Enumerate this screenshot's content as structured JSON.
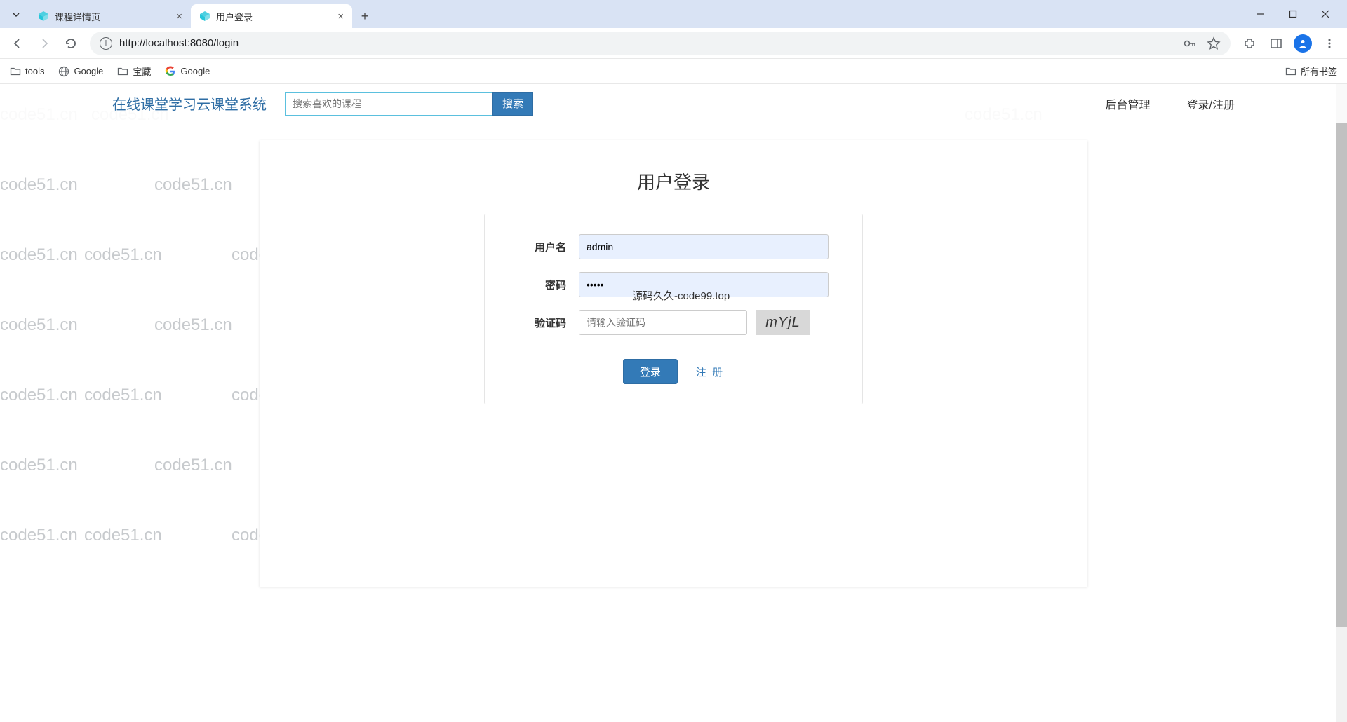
{
  "watermark_text": "code51.cn",
  "browser": {
    "tabs": [
      {
        "title": "课程详情页",
        "active": false
      },
      {
        "title": "用户登录",
        "active": true
      }
    ],
    "url": "http://localhost:8080/login",
    "bookmarks": [
      {
        "label": "tools",
        "icon": "folder"
      },
      {
        "label": "Google",
        "icon": "globe"
      },
      {
        "label": "宝藏",
        "icon": "folder"
      },
      {
        "label": "Google",
        "icon": "g"
      }
    ],
    "all_bookmarks_label": "所有书签"
  },
  "header": {
    "logo": "在线课堂学习云课堂系统",
    "search_placeholder": "搜索喜欢的课程",
    "search_button": "搜索",
    "links": {
      "admin": "后台管理",
      "login_register": "登录/注册"
    }
  },
  "login": {
    "title": "用户登录",
    "username_label": "用户名",
    "username_value": "admin",
    "password_label": "密码",
    "password_value": "•••••",
    "captcha_label": "验证码",
    "captcha_placeholder": "请输入验证码",
    "captcha_text": "mYjL",
    "floating_text": "源码久久-code99.top",
    "login_button": "登录",
    "register_link": "注 册"
  }
}
